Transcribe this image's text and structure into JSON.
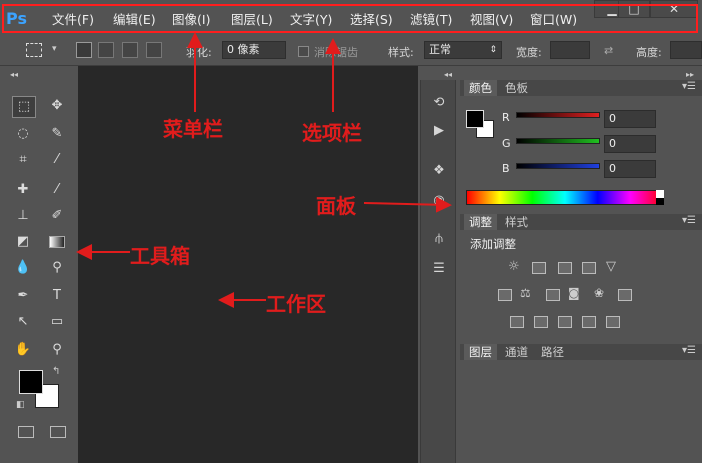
{
  "app": {
    "logo": "Ps"
  },
  "menu": {
    "items": [
      "文件(F)",
      "编辑(E)",
      "图像(I)",
      "图层(L)",
      "文字(Y)",
      "选择(S)",
      "滤镜(T)",
      "视图(V)",
      "窗口(W)"
    ],
    "window_controls": [
      "minimize",
      "maximize",
      "close"
    ]
  },
  "options_bar": {
    "feather_label": "羽化:",
    "feather_value": "0 像素",
    "antialias_label": "消除锯齿",
    "style_label": "样式:",
    "style_value": "正常",
    "width_label": "宽度:",
    "height_label": "高度:"
  },
  "color_panel": {
    "tabs": [
      "颜色",
      "色板"
    ],
    "channels": [
      {
        "label": "R",
        "value": "0",
        "color": "#e02020"
      },
      {
        "label": "G",
        "value": "0",
        "color": "#20c020"
      },
      {
        "label": "B",
        "value": "0",
        "color": "#2040e0"
      }
    ]
  },
  "adjust_panel": {
    "tabs": [
      "调整",
      "样式"
    ],
    "title": "添加调整"
  },
  "layers_panel": {
    "tabs": [
      "图层",
      "通道",
      "路径"
    ]
  },
  "annotations": {
    "menubar": "菜单栏",
    "optionsbar": "选项栏",
    "panel": "面板",
    "toolbox": "工具箱",
    "workarea": "工作区"
  },
  "colors": {
    "annotation": "#e11c1c",
    "canvas": "#282828",
    "ui": "#535353"
  }
}
